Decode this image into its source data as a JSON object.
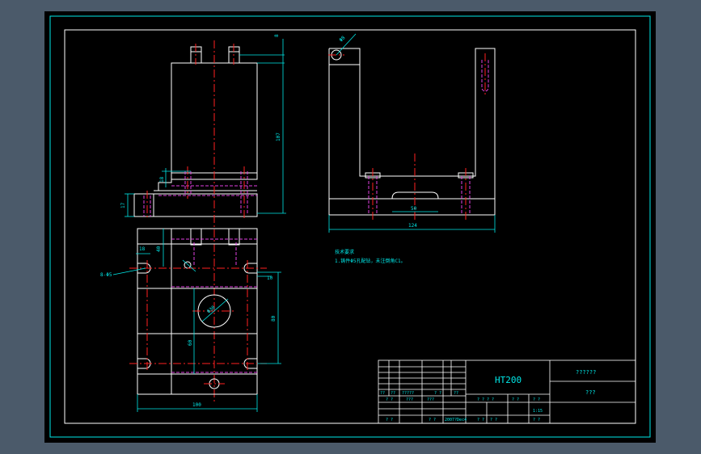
{
  "colors": {
    "background": "#4b5a6a",
    "sheet": "#000000",
    "border": "#00e8e8",
    "outline": "#ffffff",
    "centerline": "#ff2020",
    "hidden": "#e040e0",
    "dimension": "#00e8e8",
    "annotation": "#00e8e8"
  },
  "dims": {
    "top_small": "8",
    "height_main": "107",
    "height_mid": "18",
    "height_left": "17",
    "dia_top": "Φ8",
    "width_top_view": "124",
    "center_slot": "50",
    "plan_left": "18",
    "plan_top": "40",
    "plan_hole": "8-Φ5",
    "plan_right_small": "10",
    "plan_right_height": "80",
    "plan_inner": "60",
    "plan_center_dia": "Φ30",
    "plan_width": "100"
  },
  "notes": {
    "line1": "技术要求",
    "line2": "1.铸件Φ5孔配钻，未注倒角C1。"
  },
  "title_block": {
    "material": "HT200",
    "part_name": "??????",
    "drawing_no": "???",
    "grid_row1": [
      "??",
      "??",
      "?????",
      "? ?",
      "??"
    ],
    "grid_row2": [
      "? ?",
      "???",
      "???"
    ],
    "grid_row3": [
      "? ?",
      "? ?",
      "2007?Dec4"
    ],
    "mid_label": "? ? ? ?",
    "scale_header": [
      "? ?",
      "? ?"
    ],
    "scale_value": "1:15",
    "sheet_cells": [
      "? ?",
      "? ?",
      "? ?"
    ]
  }
}
